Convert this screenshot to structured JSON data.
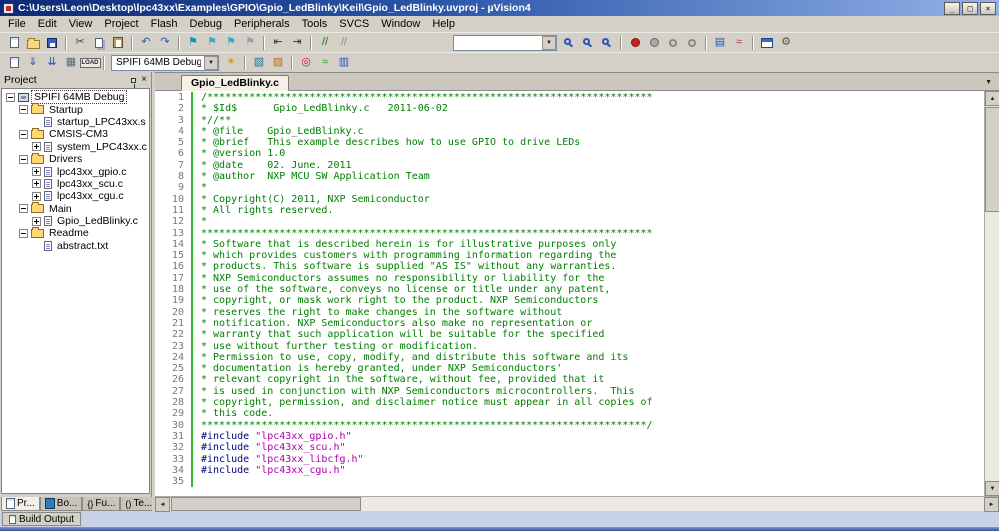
{
  "window": {
    "title": "C:\\Users\\Leon\\Desktop\\lpc43xx\\Examples\\GPIO\\Gpio_LedBlinky\\Keil\\Gpio_LedBlinky.uvproj - µVision4"
  },
  "icons": {
    "minimize": "_",
    "maximize": "□",
    "close": "×",
    "close_pane": "×",
    "dropdown": "▼",
    "up": "▲",
    "down": "▼",
    "left": "◄",
    "right": "►"
  },
  "menu": {
    "items": [
      "File",
      "Edit",
      "View",
      "Project",
      "Flash",
      "Debug",
      "Peripherals",
      "Tools",
      "SVCS",
      "Window",
      "Help"
    ]
  },
  "toolbar1": {
    "items": [
      {
        "name": "new-file-icon",
        "kind": "doc"
      },
      {
        "name": "open-file-icon",
        "kind": "folder"
      },
      {
        "name": "save-icon",
        "kind": "floppy"
      },
      {
        "kind": "sep"
      },
      {
        "name": "cut-icon",
        "glyph": "✂",
        "color": "#444444"
      },
      {
        "name": "copy-icon",
        "kind": "copy"
      },
      {
        "name": "paste-icon",
        "kind": "paste"
      },
      {
        "kind": "sep"
      },
      {
        "name": "undo-icon",
        "glyph": "↶",
        "color": "#2a52be"
      },
      {
        "name": "redo-icon",
        "glyph": "↷",
        "color": "#2a52be"
      },
      {
        "kind": "sep"
      },
      {
        "name": "bookmark-toggle-icon",
        "glyph": "⚑",
        "color": "#0099bb"
      },
      {
        "name": "bookmark-previous-icon",
        "glyph": "⚑",
        "color": "#33aacc"
      },
      {
        "name": "bookmark-next-icon",
        "glyph": "⚑",
        "color": "#33aacc"
      },
      {
        "name": "bookmark-clear-icon",
        "glyph": "⚑",
        "color": "#9aa0a8"
      },
      {
        "kind": "sep"
      },
      {
        "name": "indent-left-icon",
        "glyph": "⇤",
        "color": "#333333"
      },
      {
        "name": "indent-right-icon",
        "glyph": "⇥",
        "color": "#333333"
      },
      {
        "kind": "sep"
      },
      {
        "name": "comment-icon",
        "glyph": "//",
        "color": "#007d00"
      },
      {
        "name": "uncomment-icon",
        "glyph": "//",
        "color": "#8a8a8a"
      },
      {
        "kind": "space"
      },
      {
        "name": "find-text-combo",
        "kind": "combo",
        "width": 104,
        "value": ""
      },
      {
        "name": "find-in-files-icon",
        "kind": "magnifier"
      },
      {
        "name": "find-icon",
        "kind": "magnifier"
      },
      {
        "name": "incremental-find-icon",
        "kind": "magnifier"
      },
      {
        "kind": "sep"
      },
      {
        "name": "breakpoint-toggle-icon",
        "kind": "dot-red"
      },
      {
        "name": "breakpoint-disable-icon",
        "kind": "dot-gray"
      },
      {
        "name": "breakpoint-disable-all-icon",
        "kind": "circle"
      },
      {
        "name": "breakpoint-kill-all-icon",
        "kind": "circle"
      },
      {
        "kind": "sep"
      },
      {
        "name": "serial-window-icon",
        "glyph": "▤",
        "color": "#2255bb"
      },
      {
        "name": "analysis-window-icon",
        "glyph": "≈",
        "color": "#bb3333"
      },
      {
        "kind": "sep"
      },
      {
        "name": "window-layout-icon",
        "kind": "win"
      },
      {
        "name": "configure-icon",
        "glyph": "⚙",
        "color": "#555555"
      }
    ]
  },
  "toolbar2": {
    "items": [
      {
        "name": "translate-file-icon",
        "kind": "doc"
      },
      {
        "name": "build-icon",
        "glyph": "⇓",
        "color": "#2255bb"
      },
      {
        "name": "rebuild-all-icon",
        "glyph": "⇊",
        "color": "#2255bb"
      },
      {
        "name": "batch-build-icon",
        "glyph": "▦",
        "color": "#556677"
      },
      {
        "name": "download-flash-icon",
        "kind": "load",
        "text": "LOAD"
      },
      {
        "kind": "sep"
      },
      {
        "name": "target-select-combo",
        "kind": "combo",
        "width": 108,
        "value": "SPIFI 64MB Debug"
      },
      {
        "name": "options-for-target-icon",
        "glyph": "✶",
        "color": "#cc9900"
      },
      {
        "kind": "sep"
      },
      {
        "name": "manage-workspace-icon",
        "glyph": "▧",
        "color": "#227799"
      },
      {
        "name": "manage-components-icon",
        "glyph": "▨",
        "color": "#aa7722"
      },
      {
        "kind": "sep"
      },
      {
        "name": "debug-session-icon",
        "glyph": "◎",
        "color": "#cc2222"
      },
      {
        "name": "logic-analyzer-icon",
        "glyph": "≈",
        "color": "#22aa22"
      },
      {
        "name": "system-viewer-icon",
        "glyph": "▥",
        "color": "#2255bb"
      }
    ]
  },
  "project_panel": {
    "title": "Project",
    "tree": [
      {
        "label": "SPIFI 64MB Debug",
        "level": 0,
        "expander": "minus",
        "icon": "target",
        "selected": true
      },
      {
        "label": "Startup",
        "level": 1,
        "expander": "minus",
        "icon": "folder"
      },
      {
        "label": "startup_LPC43xx.s",
        "level": 2,
        "expander": "none",
        "icon": "file"
      },
      {
        "label": "CMSIS-CM3",
        "level": 1,
        "expander": "minus",
        "icon": "folder"
      },
      {
        "label": "system_LPC43xx.c",
        "level": 2,
        "expander": "plus",
        "icon": "file"
      },
      {
        "label": "Drivers",
        "level": 1,
        "expander": "minus",
        "icon": "folder"
      },
      {
        "label": "lpc43xx_gpio.c",
        "level": 2,
        "expander": "plus",
        "icon": "file"
      },
      {
        "label": "lpc43xx_scu.c",
        "level": 2,
        "expander": "plus",
        "icon": "file"
      },
      {
        "label": "lpc43xx_cgu.c",
        "level": 2,
        "expander": "plus",
        "icon": "file"
      },
      {
        "label": "Main",
        "level": 1,
        "expander": "minus",
        "icon": "folder"
      },
      {
        "label": "Gpio_LedBlinky.c",
        "level": 2,
        "expander": "plus",
        "icon": "file"
      },
      {
        "label": "Readme",
        "level": 1,
        "expander": "minus",
        "icon": "folder"
      },
      {
        "label": "abstract.txt",
        "level": 2,
        "expander": "none",
        "icon": "file"
      }
    ],
    "tabs": [
      {
        "name": "project",
        "label": "Pr...",
        "icon_kind": "k-doc",
        "active": true
      },
      {
        "name": "books",
        "label": "Bo...",
        "icon_kind": "k-book",
        "active": false
      },
      {
        "name": "functions",
        "label": "Fu...",
        "icon_glyph": "{}",
        "active": false
      },
      {
        "name": "templates",
        "label": "Te...",
        "icon_glyph": "()",
        "active": false
      }
    ]
  },
  "editor": {
    "tab": "Gpio_LedBlinky.c",
    "lines": [
      {
        "n": "1",
        "s": [
          [
            "c",
            "/**************************************************************************"
          ]
        ]
      },
      {
        "n": "2",
        "s": [
          [
            "c",
            "* $Id$      Gpio_LedBlinky.c   2011-06-02"
          ]
        ]
      },
      {
        "n": "3",
        "s": [
          [
            "c",
            "*//**"
          ]
        ]
      },
      {
        "n": "4",
        "s": [
          [
            "c",
            "* @file    Gpio_LedBlinky.c"
          ]
        ]
      },
      {
        "n": "5",
        "s": [
          [
            "c",
            "* @brief   This example describes how to use GPIO to drive LEDs"
          ]
        ]
      },
      {
        "n": "6",
        "s": [
          [
            "c",
            "* @version 1.0"
          ]
        ]
      },
      {
        "n": "7",
        "s": [
          [
            "c",
            "* @date    02. June. 2011"
          ]
        ]
      },
      {
        "n": "8",
        "s": [
          [
            "c",
            "* @author  NXP MCU SW Application Team"
          ]
        ]
      },
      {
        "n": "9",
        "s": [
          [
            "c",
            "*"
          ]
        ]
      },
      {
        "n": "10",
        "s": [
          [
            "c",
            "* Copyright(C) 2011, NXP Semiconductor"
          ]
        ]
      },
      {
        "n": "11",
        "s": [
          [
            "c",
            "* All rights reserved."
          ]
        ]
      },
      {
        "n": "12",
        "s": [
          [
            "c",
            "*"
          ]
        ]
      },
      {
        "n": "13",
        "s": [
          [
            "c",
            "***************************************************************************"
          ]
        ]
      },
      {
        "n": "14",
        "s": [
          [
            "c",
            "* Software that is described herein is for illustrative purposes only"
          ]
        ]
      },
      {
        "n": "15",
        "s": [
          [
            "c",
            "* which provides customers with programming information regarding the"
          ]
        ]
      },
      {
        "n": "16",
        "s": [
          [
            "c",
            "* products. This software is supplied \"AS IS\" without any warranties."
          ]
        ]
      },
      {
        "n": "17",
        "s": [
          [
            "c",
            "* NXP Semiconductors assumes no responsibility or liability for the"
          ]
        ]
      },
      {
        "n": "18",
        "s": [
          [
            "c",
            "* use of the software, conveys no license or title under any patent,"
          ]
        ]
      },
      {
        "n": "19",
        "s": [
          [
            "c",
            "* copyright, or mask work right to the product. NXP Semiconductors"
          ]
        ]
      },
      {
        "n": "20",
        "s": [
          [
            "c",
            "* reserves the right to make changes in the software without"
          ]
        ]
      },
      {
        "n": "21",
        "s": [
          [
            "c",
            "* notification. NXP Semiconductors also make no representation or"
          ]
        ]
      },
      {
        "n": "22",
        "s": [
          [
            "c",
            "* warranty that such application will be suitable for the specified"
          ]
        ]
      },
      {
        "n": "23",
        "s": [
          [
            "c",
            "* use without further testing or modification."
          ]
        ]
      },
      {
        "n": "24",
        "s": [
          [
            "c",
            "* Permission to use, copy, modify, and distribute this software and its"
          ]
        ]
      },
      {
        "n": "25",
        "s": [
          [
            "c",
            "* documentation is hereby granted, under NXP Semiconductors'"
          ]
        ]
      },
      {
        "n": "26",
        "s": [
          [
            "c",
            "* relevant copyright in the software, without fee, provided that it"
          ]
        ]
      },
      {
        "n": "27",
        "s": [
          [
            "c",
            "* is used in conjunction with NXP Semiconductors microcontrollers.  This"
          ]
        ]
      },
      {
        "n": "28",
        "s": [
          [
            "c",
            "* copyright, permission, and disclaimer notice must appear in all copies of"
          ]
        ]
      },
      {
        "n": "29",
        "s": [
          [
            "c",
            "* this code."
          ]
        ]
      },
      {
        "n": "30",
        "s": [
          [
            "c",
            "**************************************************************************/"
          ]
        ]
      },
      {
        "n": "31",
        "s": [
          [
            "d",
            "#include "
          ],
          [
            "s",
            "\"lpc43xx_gpio.h\""
          ]
        ]
      },
      {
        "n": "32",
        "s": [
          [
            "d",
            "#include "
          ],
          [
            "s",
            "\"lpc43xx_scu.h\""
          ]
        ]
      },
      {
        "n": "33",
        "s": [
          [
            "d",
            "#include "
          ],
          [
            "s",
            "\"lpc43xx_libcfg.h\""
          ]
        ]
      },
      {
        "n": "34",
        "s": [
          [
            "d",
            "#include "
          ],
          [
            "s",
            "\"lpc43xx_cgu.h\""
          ]
        ]
      },
      {
        "n": "35",
        "s": []
      }
    ]
  },
  "status": {
    "build_output": "Build Output"
  }
}
